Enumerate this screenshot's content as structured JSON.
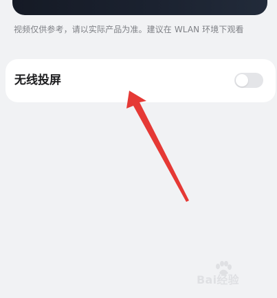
{
  "video": {
    "disclaimer": "视频仅供参考，请以实际产品为准。建议在 WLAN 环境下观看"
  },
  "settings": {
    "wireless_projection": {
      "label": "无线投屏",
      "enabled": false
    }
  },
  "colors": {
    "background": "#f1f2f4",
    "card": "#ffffff",
    "toggle_off": "#e4e5e8",
    "arrow": "#e53935",
    "text_primary": "#1c1c1e",
    "text_secondary": "#7d7f84"
  },
  "watermark": {
    "text": "Bai经验"
  }
}
